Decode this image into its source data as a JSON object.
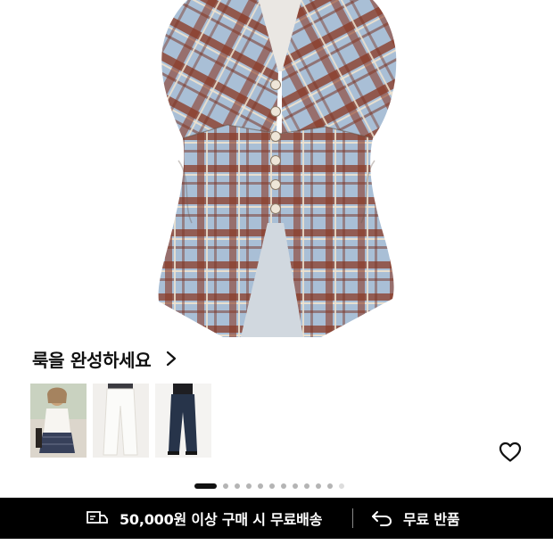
{
  "look": {
    "title": "룩을 완성하세요",
    "thumbnails": [
      {
        "label": "look-model-plaid-skirt"
      },
      {
        "label": "white-wide-pants"
      },
      {
        "label": "navy-wide-jeans"
      }
    ]
  },
  "wishlist": {
    "icon": "heart-outline-icon"
  },
  "pagination": {
    "total": 12,
    "active": 1
  },
  "promo": {
    "shipping_text": "50,000원 이상 구매 시 무료배송",
    "return_text": "무료 반품",
    "shipping_icon": "delivery-truck-icon",
    "return_icon": "return-arrow-icon",
    "bar_color": "#000000"
  },
  "colors": {
    "plaid_base": "#a9bfd6",
    "plaid_brown": "#8a3b26",
    "plaid_cream": "#efe3cf"
  }
}
